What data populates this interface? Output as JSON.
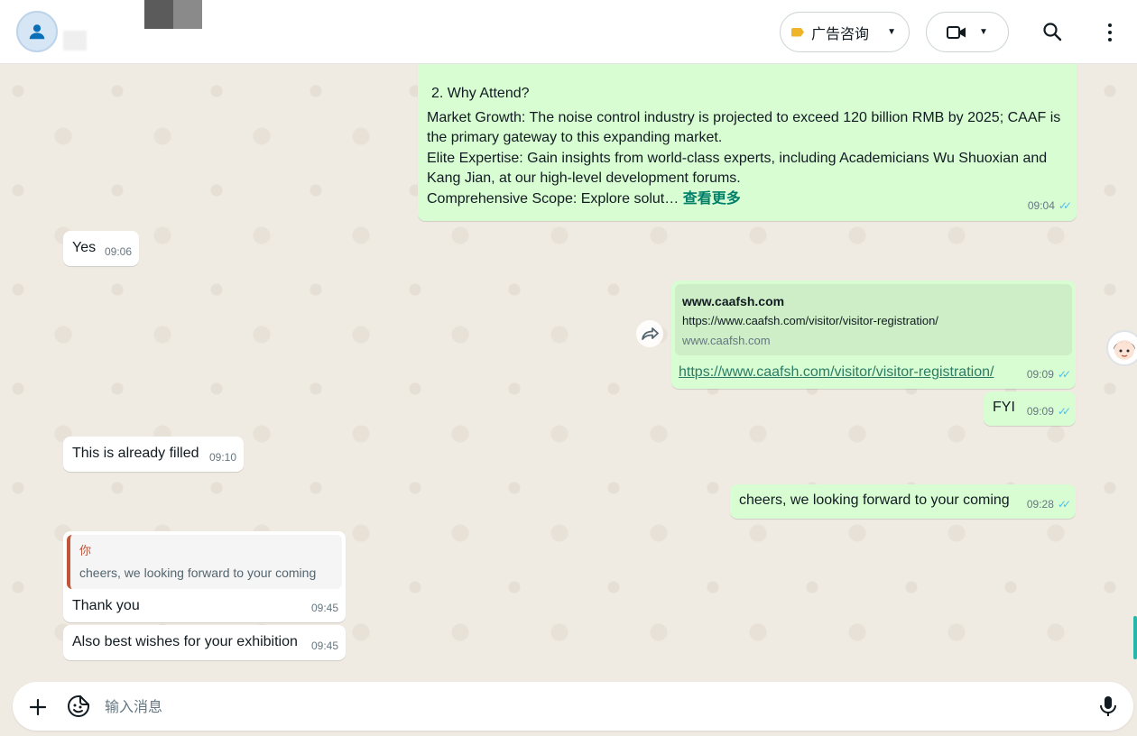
{
  "header": {
    "label_button": "广告咨询"
  },
  "messages": {
    "why_attend": {
      "title": "2.  Why Attend?",
      "line1": "Market Growth: The noise control industry is projected to exceed 120 billion RMB by 2025; CAAF is the primary gateway to this expanding market.",
      "line2": "Elite Expertise: Gain insights from world-class experts, including Academicians Wu Shuoxian and Kang Jian, at our high-level development forums.",
      "line3": "Comprehensive Scope: Explore solut…",
      "read_more": "查看更多",
      "time": "09:04"
    },
    "yes": {
      "text": "Yes",
      "time": "09:06"
    },
    "link": {
      "site": "www.caafsh.com",
      "url_preview": "https://www.caafsh.com/visitor/visitor-registration/",
      "domain": "www.caafsh.com",
      "url": "https://www.caafsh.com/visitor/visitor-registration/",
      "time": "09:09"
    },
    "fyi": {
      "text": "FYI",
      "time": "09:09"
    },
    "filled": {
      "text": "This is already filled",
      "time": "09:10"
    },
    "cheers": {
      "text": "cheers, we looking forward to your coming",
      "time": "09:28"
    },
    "thank": {
      "quote_author": "你",
      "quote_text": "cheers, we looking forward to your coming",
      "text": "Thank you",
      "time": "09:45"
    },
    "wishes": {
      "text": "Also best wishes for your exhibition",
      "time": "09:45"
    }
  },
  "composer": {
    "placeholder": "输入消息"
  },
  "colors": {
    "outgoing": "#d9fdd3",
    "incoming": "#ffffff",
    "accent": "#008069",
    "read_ticks": "#53bdeb",
    "label_tag": "#f0b429"
  },
  "icons": [
    "person-icon",
    "label-icon",
    "chevron-down-icon",
    "video-icon",
    "search-icon",
    "more-vert-icon",
    "read-ticks-icon",
    "forward-icon",
    "plus-icon",
    "sticker-icon",
    "mic-icon"
  ]
}
